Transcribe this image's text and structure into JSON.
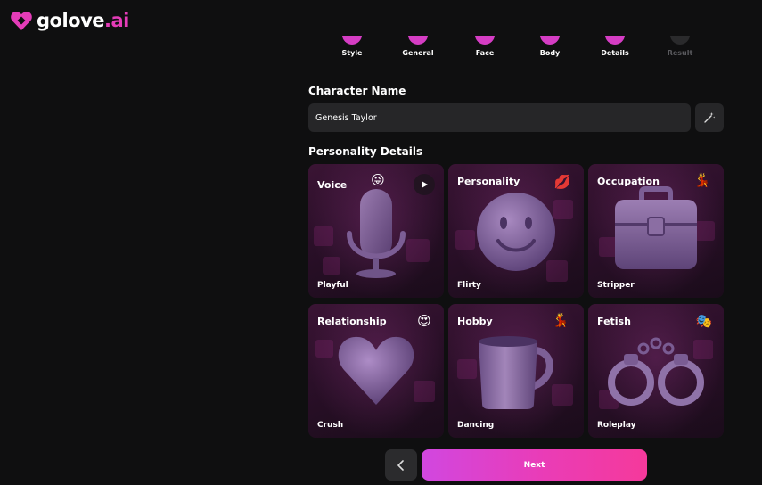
{
  "brand": {
    "name_main": "golove",
    "name_suffix": ".ai",
    "accent": "#e43cb8"
  },
  "steps": [
    {
      "label": "Style",
      "state": "done"
    },
    {
      "label": "General",
      "state": "done"
    },
    {
      "label": "Face",
      "state": "done"
    },
    {
      "label": "Body",
      "state": "done"
    },
    {
      "label": "Details",
      "state": "done"
    },
    {
      "label": "Result",
      "state": "todo"
    }
  ],
  "character_name": {
    "title": "Character Name",
    "value": "Genesis Taylor",
    "generate_icon": "magic-wand-icon"
  },
  "personality": {
    "title": "Personality Details",
    "cards": [
      {
        "title": "Voice",
        "value": "Playful",
        "emoji": "😜",
        "icon": "microphone"
      },
      {
        "title": "Personality",
        "value": "Flirty",
        "emoji": "💋",
        "icon": "smiley"
      },
      {
        "title": "Occupation",
        "value": "Stripper",
        "emoji": "💃",
        "icon": "briefcase"
      },
      {
        "title": "Relationship",
        "value": "Crush",
        "emoji": "😍",
        "icon": "heart"
      },
      {
        "title": "Hobby",
        "value": "Dancing",
        "emoji": "💃",
        "icon": "mug"
      },
      {
        "title": "Fetish",
        "value": "Roleplay",
        "emoji": "🎭",
        "icon": "handcuffs"
      }
    ]
  },
  "nav": {
    "back_icon": "chevron-left-icon",
    "next_label": "Next"
  }
}
